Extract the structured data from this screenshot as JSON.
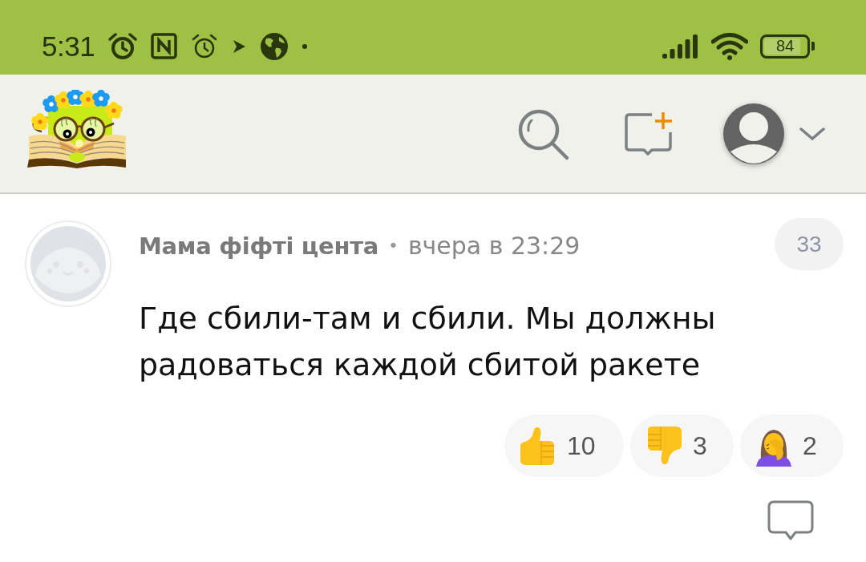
{
  "status_bar": {
    "time": "5:31",
    "battery": "84"
  },
  "comment": {
    "author": "Мама фіфті цента",
    "separator": "•",
    "time": "вчера в 23:29",
    "badge": "33",
    "text": "Где сбили-там и сбили. Мы должны радоваться каждой сбитой ракете",
    "reactions": [
      {
        "kind": "thumbs_up",
        "count": "10"
      },
      {
        "kind": "thumbs_down",
        "count": "3"
      },
      {
        "kind": "facepalm",
        "count": "2"
      }
    ]
  }
}
